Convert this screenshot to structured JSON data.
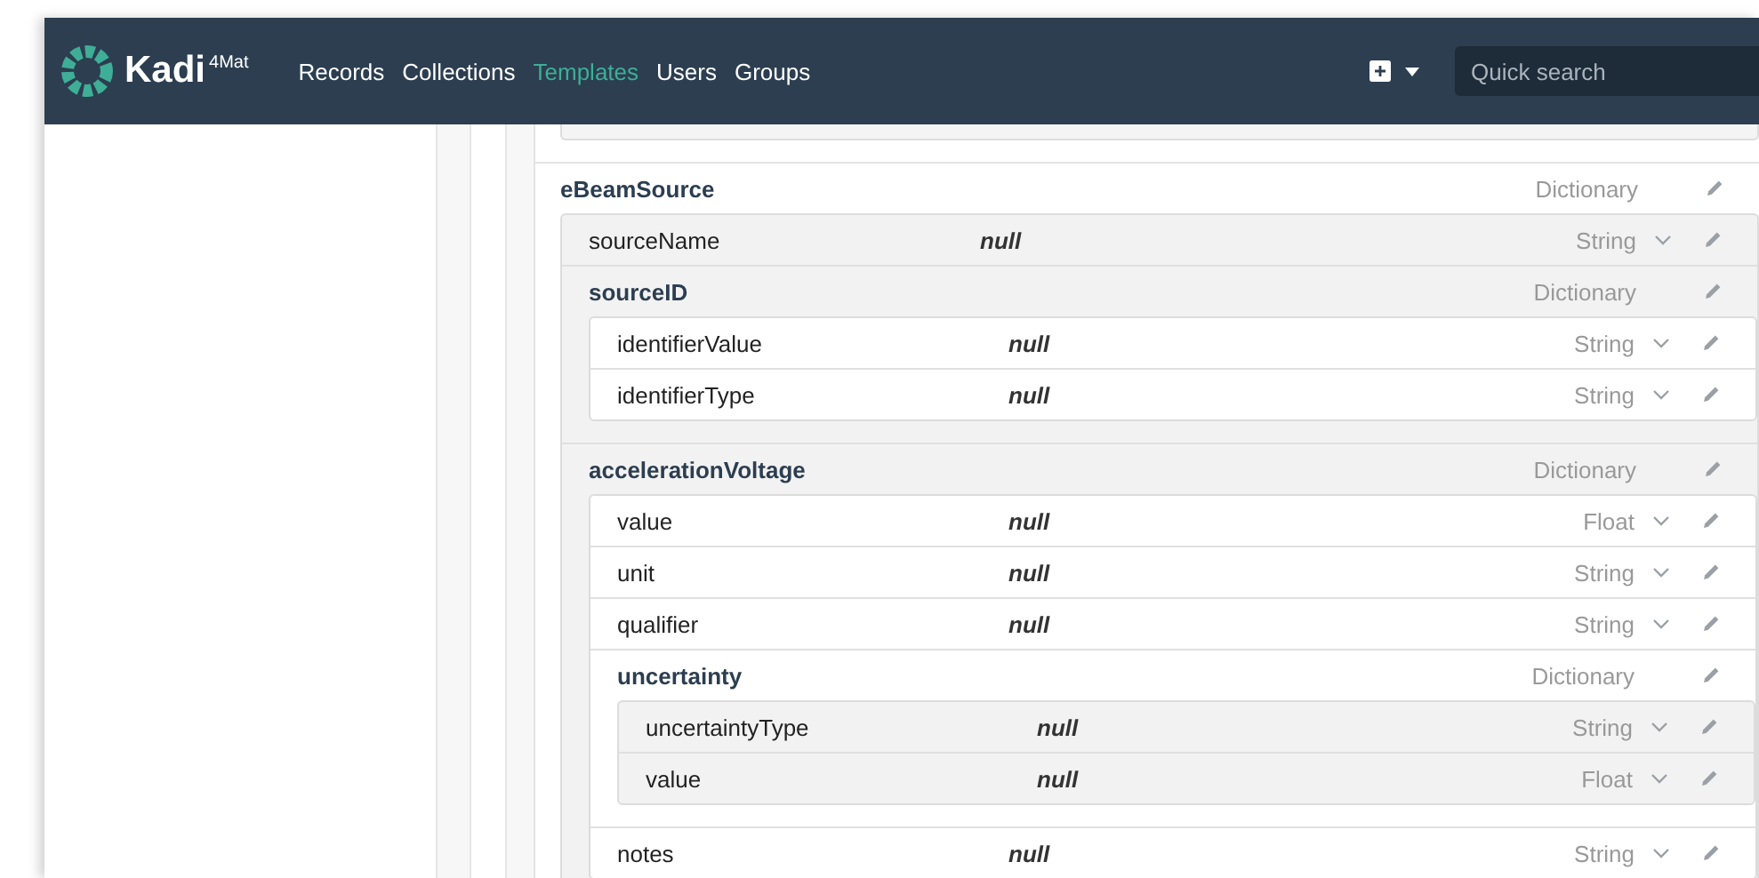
{
  "brand": {
    "name": "Kadi",
    "sup": "4Mat"
  },
  "nav": [
    {
      "label": "Records",
      "selected": false
    },
    {
      "label": "Collections",
      "selected": false
    },
    {
      "label": "Templates",
      "selected": true
    },
    {
      "label": "Users",
      "selected": false
    },
    {
      "label": "Groups",
      "selected": false
    }
  ],
  "search": {
    "placeholder": "Quick search"
  },
  "tree": [
    {
      "key": "eBeamSource",
      "kind": "dict",
      "type": "Dictionary",
      "children": [
        {
          "key": "sourceName",
          "kind": "value",
          "type": "String",
          "value": "null"
        },
        {
          "key": "sourceID",
          "kind": "dict",
          "type": "Dictionary",
          "children": [
            {
              "key": "identifierValue",
              "kind": "value",
              "type": "String",
              "value": "null"
            },
            {
              "key": "identifierType",
              "kind": "value",
              "type": "String",
              "value": "null"
            }
          ]
        },
        {
          "key": "accelerationVoltage",
          "kind": "dict",
          "type": "Dictionary",
          "children": [
            {
              "key": "value",
              "kind": "value",
              "type": "Float",
              "value": "null"
            },
            {
              "key": "unit",
              "kind": "value",
              "type": "String",
              "value": "null"
            },
            {
              "key": "qualifier",
              "kind": "value",
              "type": "String",
              "value": "null"
            },
            {
              "key": "uncertainty",
              "kind": "dict",
              "type": "Dictionary",
              "children": [
                {
                  "key": "uncertaintyType",
                  "kind": "value",
                  "type": "String",
                  "value": "null"
                },
                {
                  "key": "value",
                  "kind": "value",
                  "type": "Float",
                  "value": "null"
                }
              ]
            },
            {
              "key": "notes",
              "kind": "value",
              "type": "String",
              "value": "null"
            }
          ]
        }
      ]
    }
  ]
}
